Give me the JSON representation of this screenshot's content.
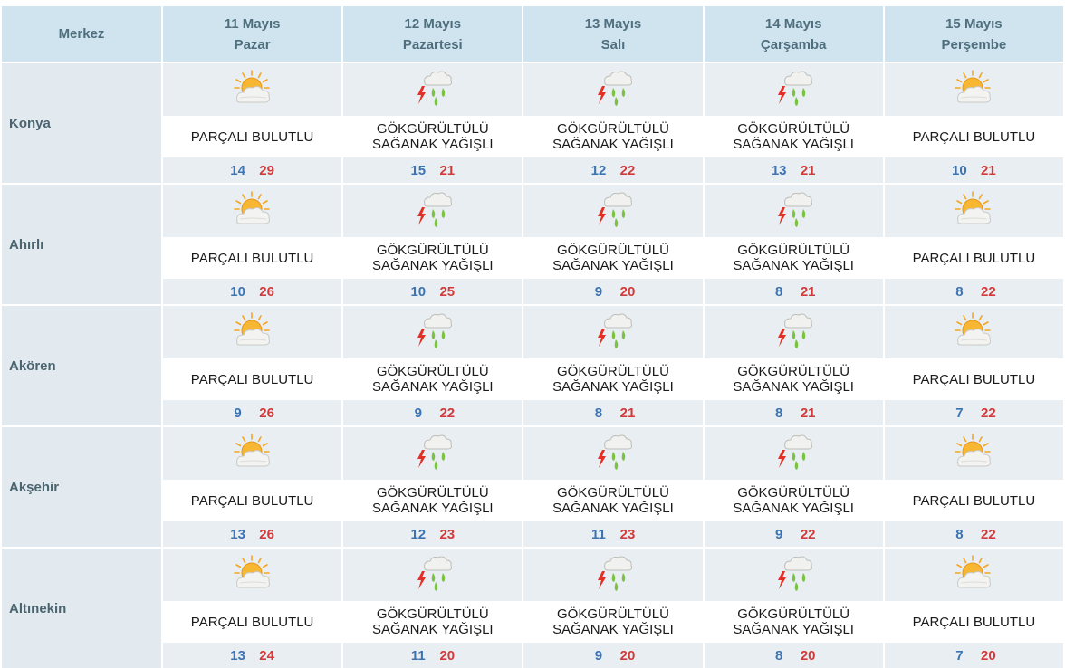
{
  "header": {
    "merkez_label": "Merkez",
    "days": [
      {
        "date": "11 Mayıs",
        "weekday": "Pazar"
      },
      {
        "date": "12 Mayıs",
        "weekday": "Pazartesi"
      },
      {
        "date": "13 Mayıs",
        "weekday": "Salı"
      },
      {
        "date": "14 Mayıs",
        "weekday": "Çarşamba"
      },
      {
        "date": "15 Mayıs",
        "weekday": "Perşembe"
      }
    ]
  },
  "conditions": {
    "partly_cloudy": {
      "line1": "PARÇALI BULUTLU",
      "line2": "",
      "icon": "partly-cloudy-icon"
    },
    "thunder_showers": {
      "line1": "GÖKGÜRÜLTÜLÜ",
      "line2": "SAĞANAK YAĞIŞLI",
      "icon": "thunderstorm-icon"
    }
  },
  "colors": {
    "header_bg": "#cfe4ee",
    "low_temp": "#3b73b3",
    "high_temp": "#d23a3a"
  },
  "rows": [
    {
      "city": "Konya",
      "forecast": [
        {
          "cond": "partly_cloudy",
          "desc1": "PARÇALI BULUTLU",
          "desc2": "",
          "low": "14",
          "high": "29"
        },
        {
          "cond": "thunder_showers",
          "desc1": "GÖKGÜRÜLTÜLÜ",
          "desc2": "SAĞANAK YAĞIŞLI",
          "low": "15",
          "high": "21"
        },
        {
          "cond": "thunder_showers",
          "desc1": "GÖKGÜRÜLTÜLÜ",
          "desc2": "SAĞANAK YAĞIŞLI",
          "low": "12",
          "high": "22"
        },
        {
          "cond": "thunder_showers",
          "desc1": "GÖKGÜRÜLTÜLÜ",
          "desc2": "SAĞANAK YAĞIŞLI",
          "low": "13",
          "high": "21"
        },
        {
          "cond": "partly_cloudy",
          "desc1": "PARÇALI BULUTLU",
          "desc2": "",
          "low": "10",
          "high": "21"
        }
      ]
    },
    {
      "city": "Ahırlı",
      "forecast": [
        {
          "cond": "partly_cloudy",
          "desc1": "PARÇALI BULUTLU",
          "desc2": "",
          "low": "10",
          "high": "26"
        },
        {
          "cond": "thunder_showers",
          "desc1": "GÖKGÜRÜLTÜLÜ",
          "desc2": "SAĞANAK YAĞIŞLI",
          "low": "10",
          "high": "25"
        },
        {
          "cond": "thunder_showers",
          "desc1": "GÖKGÜRÜLTÜLÜ",
          "desc2": "SAĞANAK YAĞIŞLI",
          "low": "9",
          "high": "20"
        },
        {
          "cond": "thunder_showers",
          "desc1": "GÖKGÜRÜLTÜLÜ",
          "desc2": "SAĞANAK YAĞIŞLI",
          "low": "8",
          "high": "21"
        },
        {
          "cond": "partly_cloudy",
          "desc1": "PARÇALI BULUTLU",
          "desc2": "",
          "low": "8",
          "high": "22"
        }
      ]
    },
    {
      "city": "Akören",
      "forecast": [
        {
          "cond": "partly_cloudy",
          "desc1": "PARÇALI BULUTLU",
          "desc2": "",
          "low": "9",
          "high": "26"
        },
        {
          "cond": "thunder_showers",
          "desc1": "GÖKGÜRÜLTÜLÜ",
          "desc2": "SAĞANAK YAĞIŞLI",
          "low": "9",
          "high": "22"
        },
        {
          "cond": "thunder_showers",
          "desc1": "GÖKGÜRÜLTÜLÜ",
          "desc2": "SAĞANAK YAĞIŞLI",
          "low": "8",
          "high": "21"
        },
        {
          "cond": "thunder_showers",
          "desc1": "GÖKGÜRÜLTÜLÜ",
          "desc2": "SAĞANAK YAĞIŞLI",
          "low": "8",
          "high": "21"
        },
        {
          "cond": "partly_cloudy",
          "desc1": "PARÇALI BULUTLU",
          "desc2": "",
          "low": "7",
          "high": "22"
        }
      ]
    },
    {
      "city": "Akşehir",
      "forecast": [
        {
          "cond": "partly_cloudy",
          "desc1": "PARÇALI BULUTLU",
          "desc2": "",
          "low": "13",
          "high": "26"
        },
        {
          "cond": "thunder_showers",
          "desc1": "GÖKGÜRÜLTÜLÜ",
          "desc2": "SAĞANAK YAĞIŞLI",
          "low": "12",
          "high": "23"
        },
        {
          "cond": "thunder_showers",
          "desc1": "GÖKGÜRÜLTÜLÜ",
          "desc2": "SAĞANAK YAĞIŞLI",
          "low": "11",
          "high": "23"
        },
        {
          "cond": "thunder_showers",
          "desc1": "GÖKGÜRÜLTÜLÜ",
          "desc2": "SAĞANAK YAĞIŞLI",
          "low": "9",
          "high": "22"
        },
        {
          "cond": "partly_cloudy",
          "desc1": "PARÇALI BULUTLU",
          "desc2": "",
          "low": "8",
          "high": "22"
        }
      ]
    },
    {
      "city": "Altınekin",
      "forecast": [
        {
          "cond": "partly_cloudy",
          "desc1": "PARÇALI BULUTLU",
          "desc2": "",
          "low": "13",
          "high": "24"
        },
        {
          "cond": "thunder_showers",
          "desc1": "GÖKGÜRÜLTÜLÜ",
          "desc2": "SAĞANAK YAĞIŞLI",
          "low": "11",
          "high": "20"
        },
        {
          "cond": "thunder_showers",
          "desc1": "GÖKGÜRÜLTÜLÜ",
          "desc2": "SAĞANAK YAĞIŞLI",
          "low": "9",
          "high": "20"
        },
        {
          "cond": "thunder_showers",
          "desc1": "GÖKGÜRÜLTÜLÜ",
          "desc2": "SAĞANAK YAĞIŞLI",
          "low": "8",
          "high": "20"
        },
        {
          "cond": "partly_cloudy",
          "desc1": "PARÇALI BULUTLU",
          "desc2": "",
          "low": "7",
          "high": "20"
        }
      ]
    }
  ]
}
